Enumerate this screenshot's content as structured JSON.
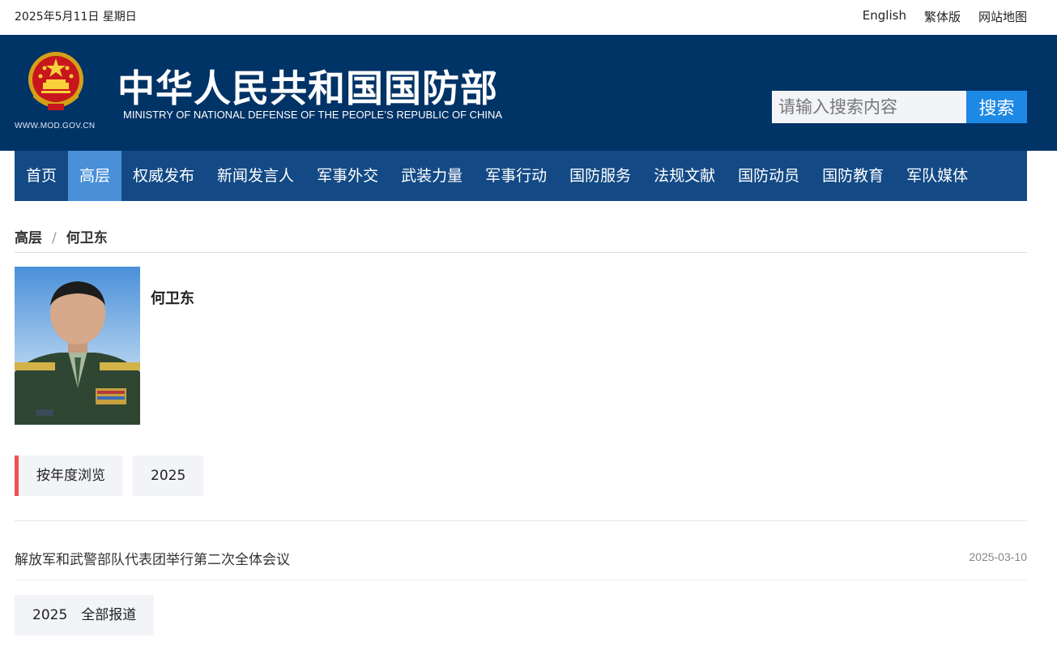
{
  "topbar": {
    "date": "2025年5月11日 星期日",
    "links": [
      "English",
      "繁体版",
      "网站地图"
    ]
  },
  "header": {
    "site_url": "WWW.MOD.GOV.CN",
    "title_cn": "中华人民共和国国防部",
    "title_en": "MINISTRY OF NATIONAL DEFENSE OF THE PEOPLE’S REPUBLIC OF CHINA",
    "search": {
      "placeholder": "请输入搜索内容",
      "button": "搜索"
    }
  },
  "nav": {
    "items": [
      "首页",
      "高层",
      "权威发布",
      "新闻发言人",
      "军事外交",
      "武装力量",
      "军事行动",
      "国防服务",
      "法规文献",
      "国防动员",
      "国防教育",
      "军队媒体"
    ],
    "active_index": 1
  },
  "breadcrumb": {
    "section": "高层",
    "separator": "/",
    "current": "何卫东"
  },
  "profile": {
    "name": "何卫东"
  },
  "year_filter": {
    "label": "按年度浏览",
    "years": [
      "2025"
    ]
  },
  "news": [
    {
      "title": "解放军和武警部队代表团举行第二次全体会议",
      "date": "2025-03-10"
    }
  ],
  "all_reports_button": "2025　全部报道",
  "colors": {
    "header_bg": "#003366",
    "nav_bg": "#134a86",
    "nav_active": "#4a90d9",
    "search_button": "#1e88e5",
    "filter_accent": "#f05050"
  }
}
